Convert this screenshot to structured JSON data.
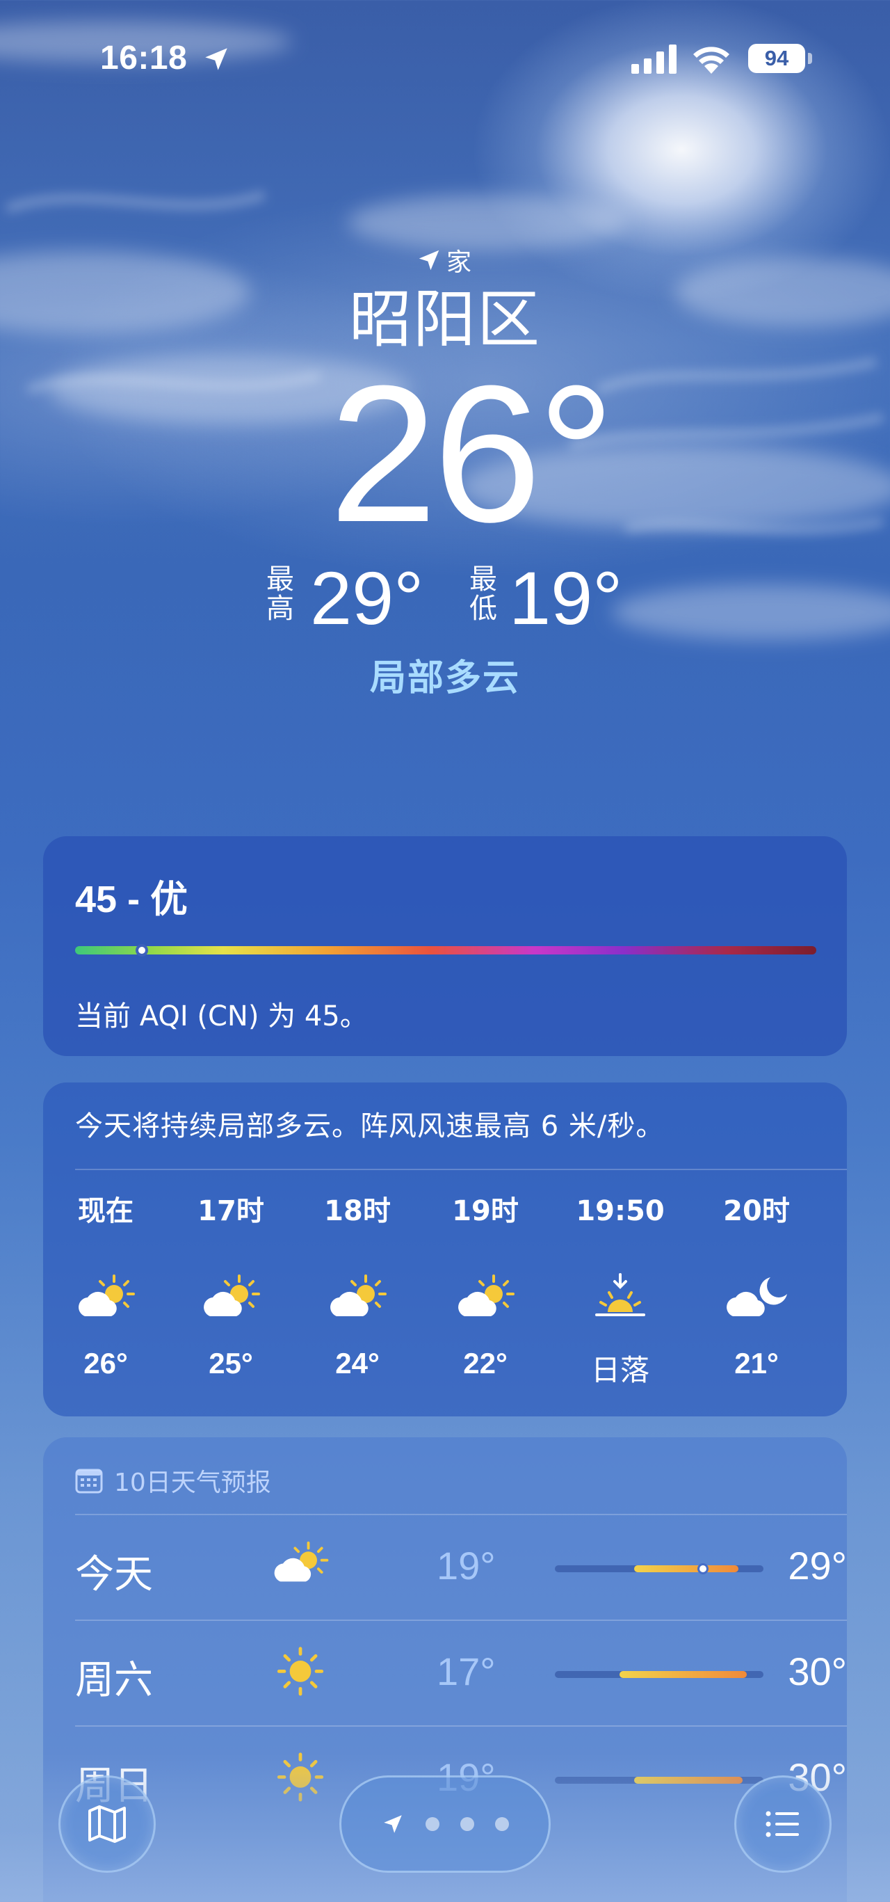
{
  "status_bar": {
    "time": "16:18",
    "battery": "94"
  },
  "header": {
    "location_tag": "家",
    "city": "昭阳区",
    "temperature": "26°",
    "high_label": "最高",
    "high": "29°",
    "low_label": "最低",
    "low": "19°",
    "condition": "局部多云"
  },
  "aqi": {
    "title": "45 - 优",
    "description": "当前 AQI (CN) 为 45。",
    "position_fraction": 0.09
  },
  "hourly": {
    "summary": "今天将持续局部多云。阵风风速最高 6 米/秒。",
    "items": [
      {
        "label": "现在",
        "icon": "partly-cloudy-day-icon",
        "temp": "26°"
      },
      {
        "label": "17时",
        "icon": "partly-cloudy-day-icon",
        "temp": "25°"
      },
      {
        "label": "18时",
        "icon": "partly-cloudy-day-icon",
        "temp": "24°"
      },
      {
        "label": "19时",
        "icon": "partly-cloudy-day-icon",
        "temp": "22°"
      },
      {
        "label": "19:50",
        "icon": "sunset-icon",
        "temp": "日落"
      },
      {
        "label": "20时",
        "icon": "partly-cloudy-night-icon",
        "temp": "21°"
      }
    ]
  },
  "daily": {
    "header": "10日天气预报",
    "days": [
      {
        "name": "今天",
        "icon": "partly-cloudy-day-icon",
        "low": "19°",
        "high": "29°",
        "range_start": 0.38,
        "range_end": 0.88,
        "current": 0.71
      },
      {
        "name": "周六",
        "icon": "sun-icon",
        "low": "17°",
        "high": "30°",
        "range_start": 0.31,
        "range_end": 0.92
      },
      {
        "name": "周日",
        "icon": "sun-icon",
        "low": "19°",
        "high": "30°",
        "range_start": 0.38,
        "range_end": 0.9
      }
    ]
  },
  "toolbar": {
    "map": "map-icon",
    "list": "list-icon"
  }
}
